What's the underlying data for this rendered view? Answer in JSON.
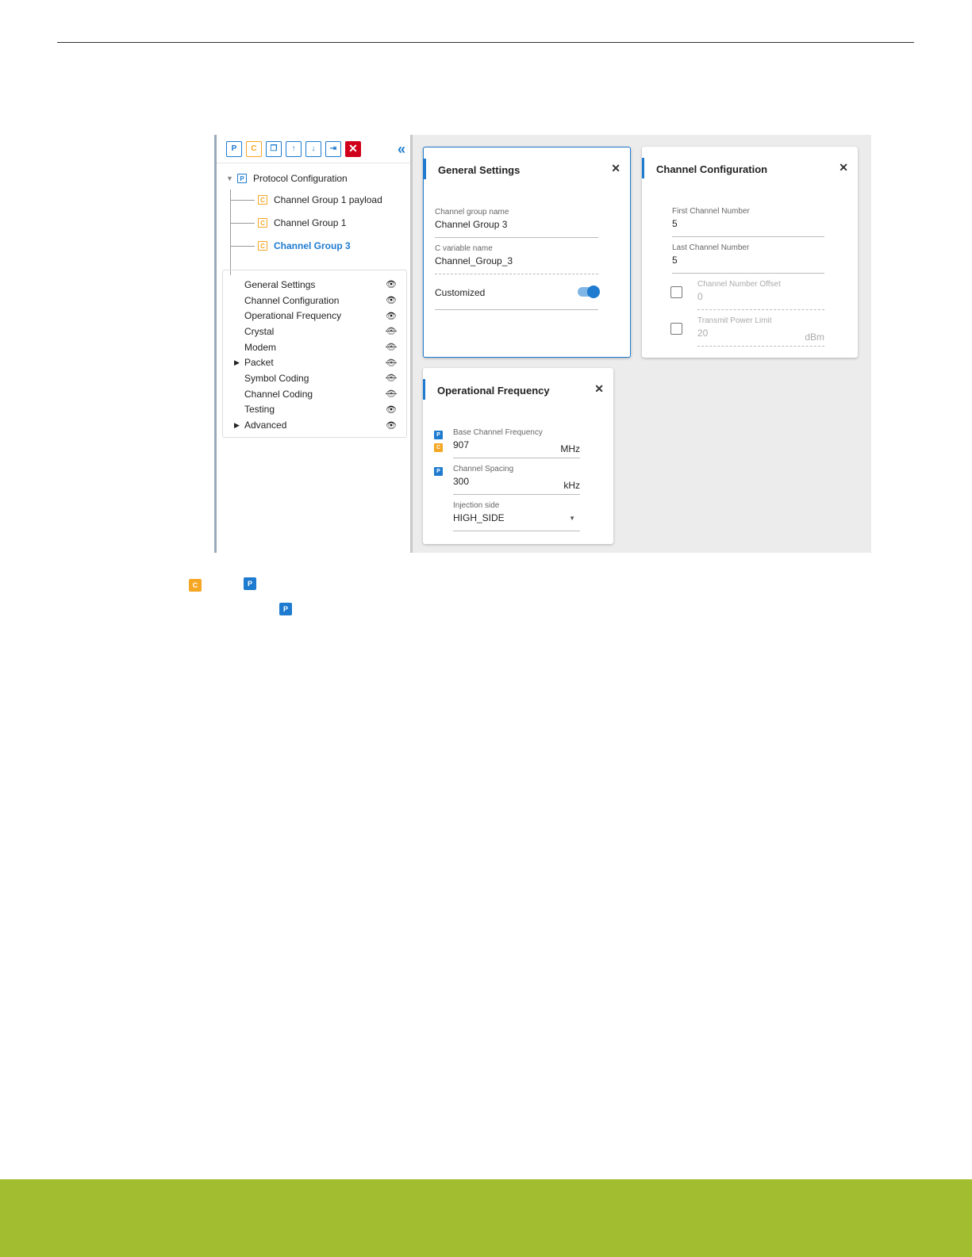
{
  "toolbar": {
    "buttons": [
      {
        "name": "add-protocol",
        "glyph": "P",
        "color": "blue"
      },
      {
        "name": "add-channel-group",
        "glyph": "C",
        "color": "orange"
      },
      {
        "name": "copy",
        "glyph": "❐",
        "color": "blue"
      },
      {
        "name": "move-up",
        "glyph": "↑",
        "color": "blue"
      },
      {
        "name": "move-down",
        "glyph": "↓",
        "color": "blue"
      },
      {
        "name": "import",
        "glyph": "⇥",
        "color": "blue"
      },
      {
        "name": "delete",
        "glyph": "✕",
        "color": "red"
      }
    ],
    "collapse_glyph": "«"
  },
  "tree": {
    "root": {
      "label": "Protocol Configuration",
      "badge": "P"
    },
    "children": [
      {
        "label": "Channel Group 1 payload",
        "badge": "C"
      },
      {
        "label": "Channel Group 1",
        "badge": "C"
      },
      {
        "label": "Channel Group 3",
        "badge": "C",
        "selected": true
      }
    ]
  },
  "panel_list": [
    {
      "label": "General Settings",
      "visible": true
    },
    {
      "label": "Channel Configuration",
      "visible": true
    },
    {
      "label": "Operational Frequency",
      "visible": true
    },
    {
      "label": "Crystal",
      "visible": false
    },
    {
      "label": "Modem",
      "visible": false
    },
    {
      "label": "Packet",
      "visible": false,
      "expandable": true
    },
    {
      "label": "Symbol Coding",
      "visible": false
    },
    {
      "label": "Channel Coding",
      "visible": false
    },
    {
      "label": "Testing",
      "visible": true
    },
    {
      "label": "Advanced",
      "visible": true,
      "expandable": true
    }
  ],
  "general_settings": {
    "title": "General Settings",
    "close": "✕",
    "group_name_label": "Channel group name",
    "group_name_value": "Channel Group 3",
    "c_var_label": "C variable name",
    "c_var_value": "Channel_Group_3",
    "customized_label": "Customized",
    "customized_on": true
  },
  "channel_configuration": {
    "title": "Channel Configuration",
    "close": "✕",
    "first_label": "First Channel Number",
    "first_value": "5",
    "last_label": "Last Channel Number",
    "last_value": "5",
    "offset_label": "Channel Number Offset",
    "offset_value": "0",
    "power_label": "Transmit Power Limit",
    "power_value": "20",
    "power_unit": "dBm"
  },
  "operational_frequency": {
    "title": "Operational Frequency",
    "close": "✕",
    "base_label": "Base Channel Frequency",
    "base_value": "907",
    "base_unit": "MHz",
    "spacing_label": "Channel Spacing",
    "spacing_value": "300",
    "spacing_unit": "kHz",
    "injection_label": "Injection side",
    "injection_value": "HIGH_SIDE"
  },
  "legend": {
    "c_badge": "C",
    "p_badge": "P",
    "p_badge_2": "P"
  },
  "colors": {
    "accent": "#1e7bd0",
    "orange": "#f5a623",
    "footer": "#a2bd30"
  }
}
